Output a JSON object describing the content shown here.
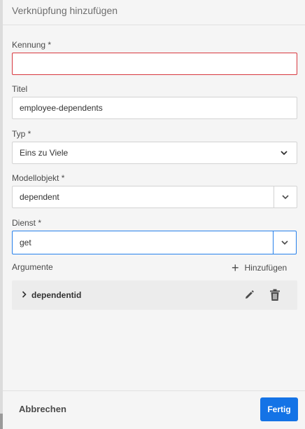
{
  "dialog": {
    "title": "Verknüpfung hinzufügen"
  },
  "fields": {
    "identifier": {
      "label": "Kennung *",
      "value": ""
    },
    "title": {
      "label": "Titel",
      "value": "employee-dependents"
    },
    "type": {
      "label": "Typ *",
      "value": "Eins zu Viele"
    },
    "model_object": {
      "label": "Modellobjekt *",
      "value": "dependent"
    },
    "service": {
      "label": "Dienst *",
      "value": "get"
    }
  },
  "arguments": {
    "label": "Argumente",
    "add_label": "Hinzufügen",
    "items": [
      {
        "name": "dependentid"
      }
    ]
  },
  "footer": {
    "cancel_label": "Abbrechen",
    "done_label": "Fertig"
  },
  "colors": {
    "accent": "#1473e6",
    "error": "#d7373f",
    "focus": "#2680eb"
  },
  "icons": [
    "plus-icon",
    "chevron-right-icon",
    "chevron-down-icon",
    "pencil-icon",
    "trash-icon"
  ]
}
